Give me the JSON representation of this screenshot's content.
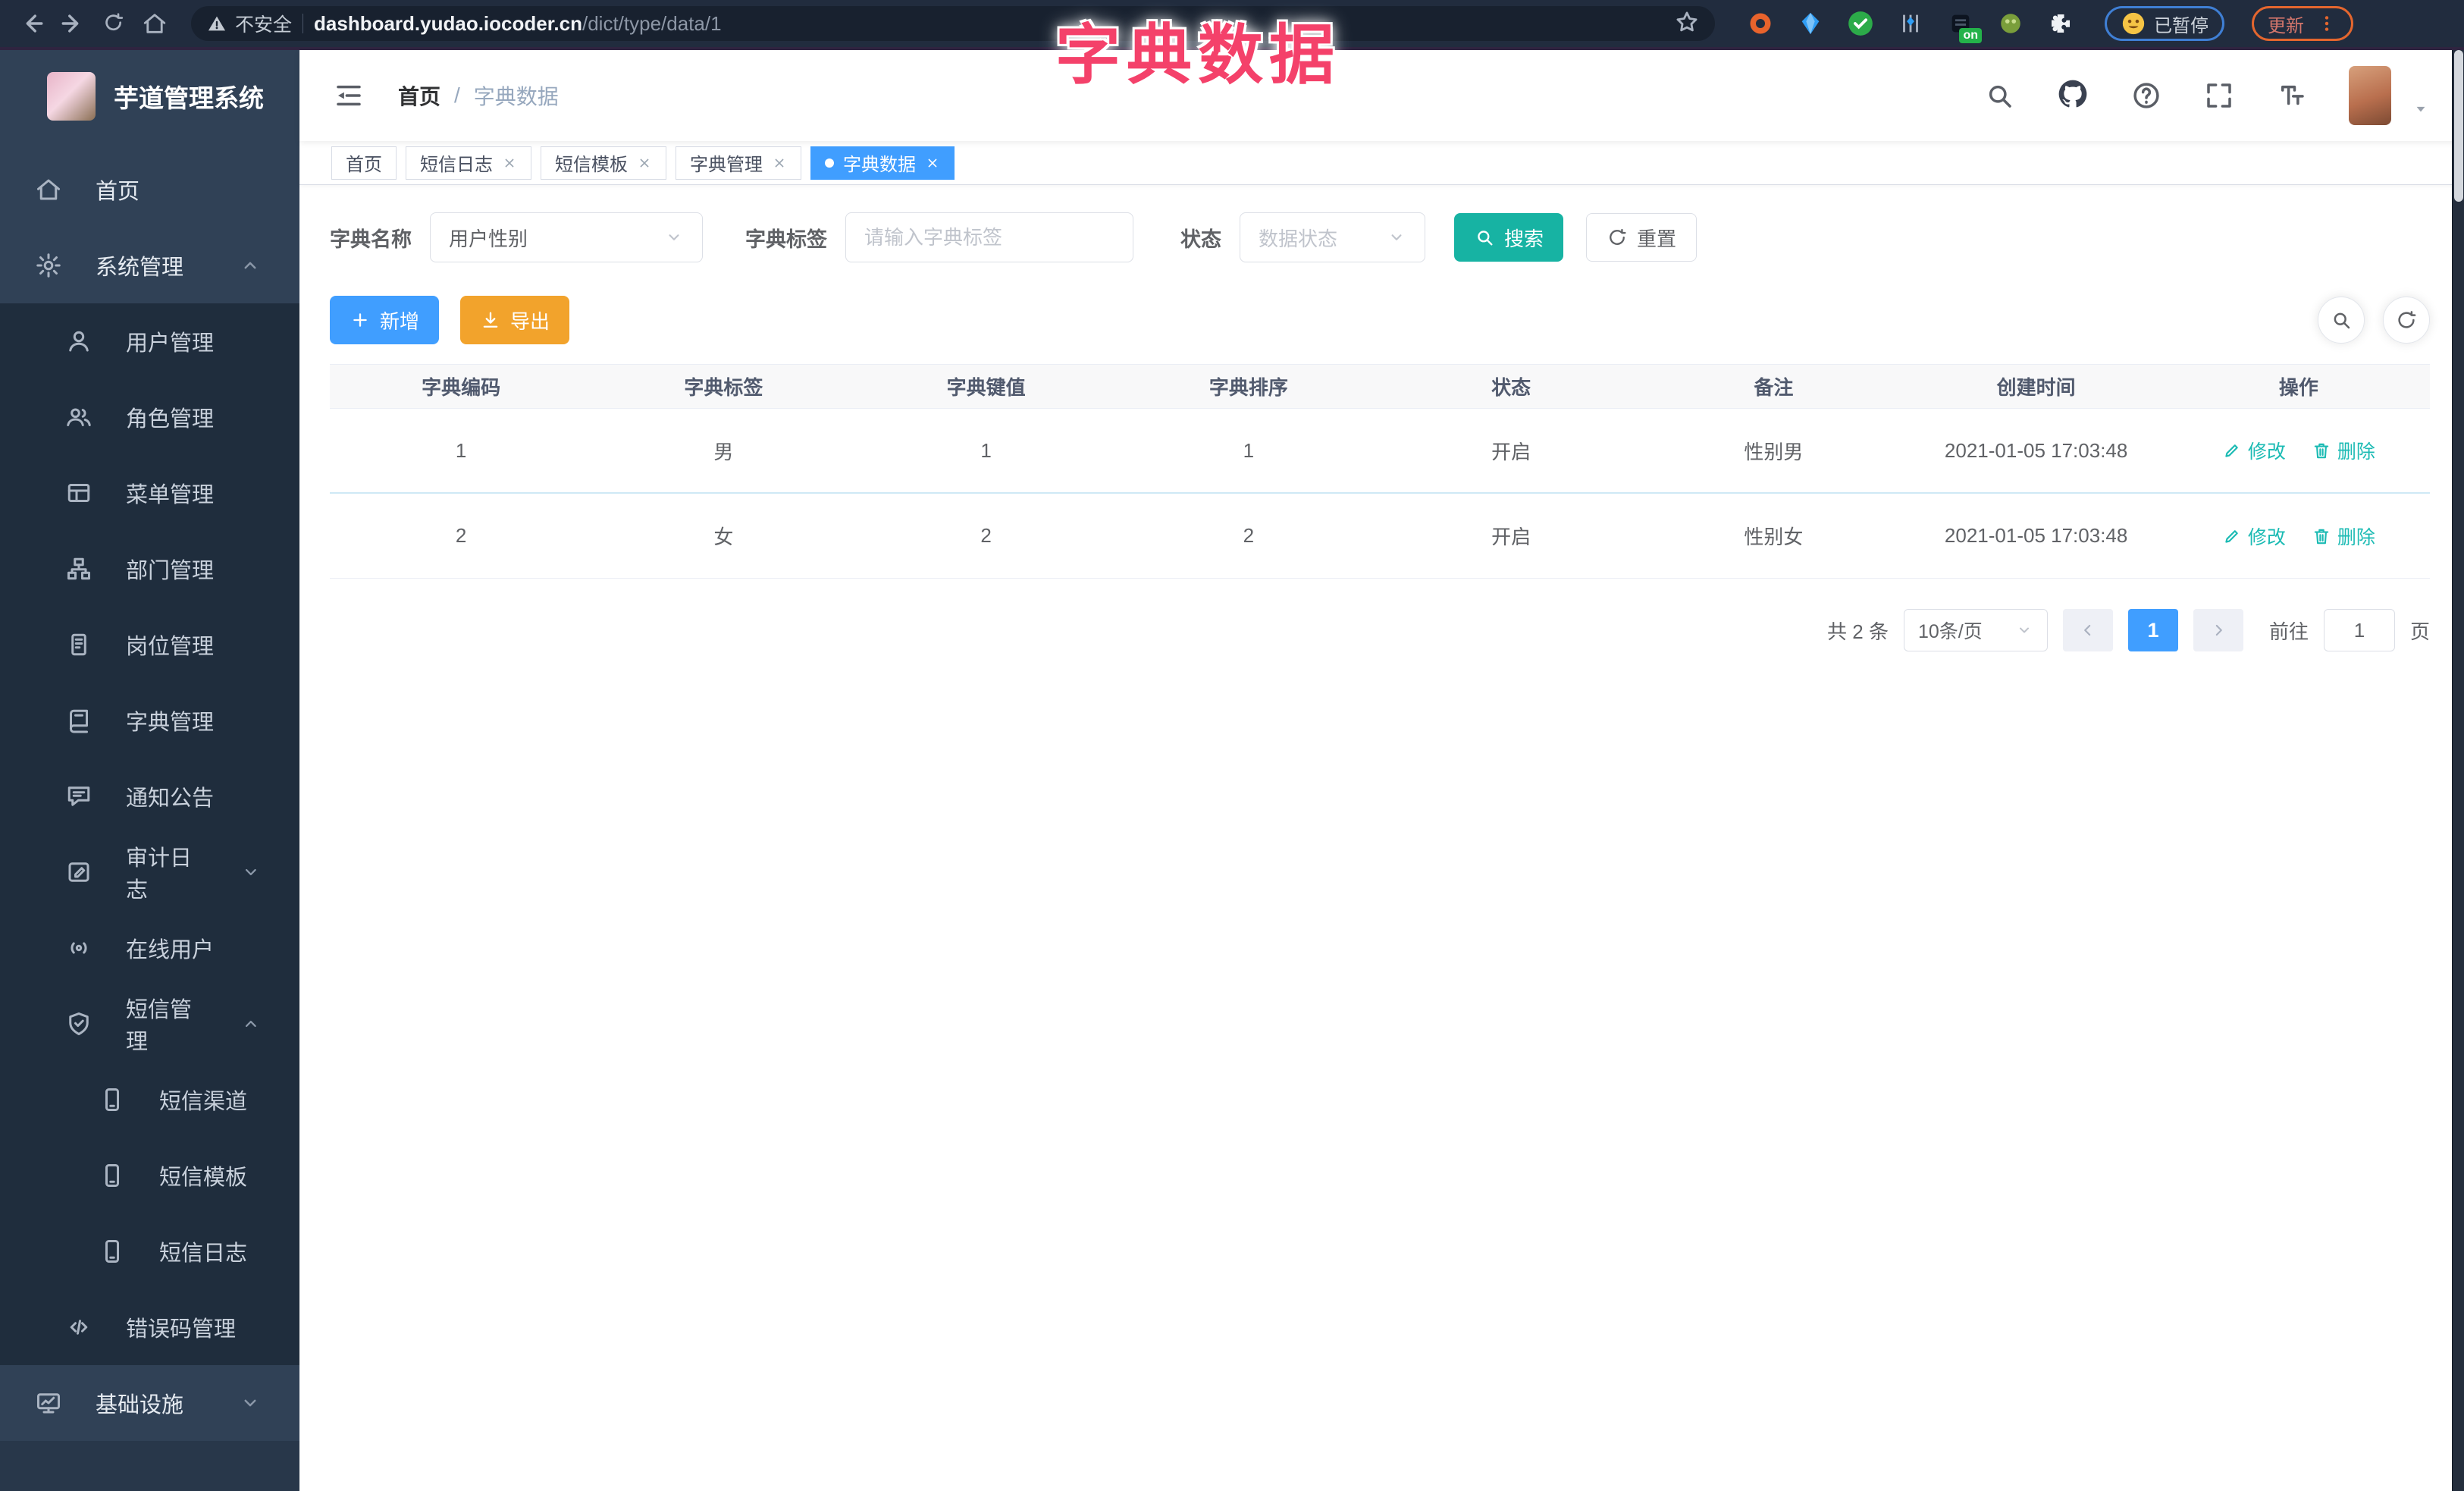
{
  "browser": {
    "security_label": "不安全",
    "url_domain": "dashboard.yudao.iocoder.cn",
    "url_path": "/dict/type/data/1",
    "extension_badge": "on",
    "paused_label": "已暂停",
    "update_label": "更新"
  },
  "overlay_title": "字典数据",
  "sidebar": {
    "logo_title": "芋道管理系统",
    "items": [
      {
        "label": "首页"
      },
      {
        "label": "系统管理"
      },
      {
        "label": "用户管理"
      },
      {
        "label": "角色管理"
      },
      {
        "label": "菜单管理"
      },
      {
        "label": "部门管理"
      },
      {
        "label": "岗位管理"
      },
      {
        "label": "字典管理"
      },
      {
        "label": "通知公告"
      },
      {
        "label": "审计日志"
      },
      {
        "label": "在线用户"
      },
      {
        "label": "短信管理"
      },
      {
        "label": "短信渠道"
      },
      {
        "label": "短信模板"
      },
      {
        "label": "短信日志"
      },
      {
        "label": "错误码管理"
      },
      {
        "label": "基础设施"
      }
    ]
  },
  "header": {
    "breadcrumb_home": "首页",
    "breadcrumb_sep": "/",
    "breadcrumb_current": "字典数据"
  },
  "tabs": [
    {
      "label": "首页"
    },
    {
      "label": "短信日志"
    },
    {
      "label": "短信模板"
    },
    {
      "label": "字典管理"
    },
    {
      "label": "字典数据"
    }
  ],
  "filters": {
    "dict_name_label": "字典名称",
    "dict_name_value": "用户性别",
    "dict_label_label": "字典标签",
    "dict_label_placeholder": "请输入字典标签",
    "status_label": "状态",
    "status_placeholder": "数据状态",
    "search_label": "搜索",
    "reset_label": "重置"
  },
  "toolbar": {
    "add_label": "新增",
    "export_label": "导出"
  },
  "table": {
    "headers": [
      "字典编码",
      "字典标签",
      "字典键值",
      "字典排序",
      "状态",
      "备注",
      "创建时间",
      "操作"
    ],
    "rows": [
      {
        "code": "1",
        "label": "男",
        "value": "1",
        "sort": "1",
        "status": "开启",
        "remark": "性别男",
        "created": "2021-01-05 17:03:48"
      },
      {
        "code": "2",
        "label": "女",
        "value": "2",
        "sort": "2",
        "status": "开启",
        "remark": "性别女",
        "created": "2021-01-05 17:03:48"
      }
    ],
    "edit_label": "修改",
    "delete_label": "删除"
  },
  "pagination": {
    "total": "共 2 条",
    "page_size": "10条/页",
    "page": "1",
    "goto_label": "前往",
    "goto_value": "1",
    "page_unit": "页"
  },
  "colors": {
    "primary": "#409eff",
    "teal": "#17b3a3",
    "warning": "#f2a32c",
    "annotation_pink": "#f4416a",
    "sidebar_bg": "#304156",
    "submenu_bg": "#1f2d3d"
  }
}
